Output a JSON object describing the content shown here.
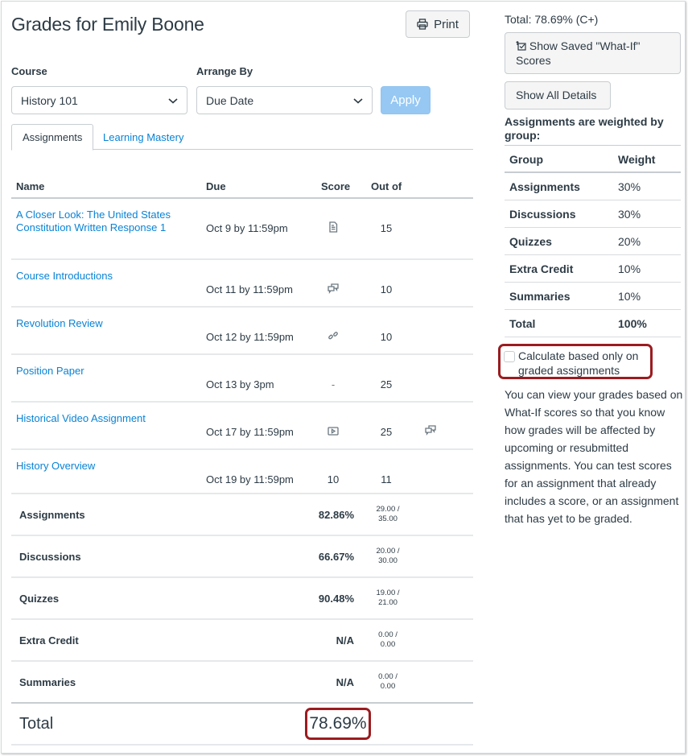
{
  "header": {
    "title": "Grades for Emily Boone",
    "print_label": "Print"
  },
  "filters": {
    "course_label": "Course",
    "course_value": "History 101",
    "arrange_label": "Arrange By",
    "arrange_value": "Due Date",
    "apply_label": "Apply"
  },
  "tabs": [
    {
      "label": "Assignments",
      "active": true
    },
    {
      "label": "Learning Mastery",
      "active": false
    }
  ],
  "table": {
    "columns": [
      "Name",
      "Due",
      "Score",
      "Out of"
    ],
    "assignments": [
      {
        "name": "A Closer Look: The United States Constitution Written Response 1",
        "due": "Oct 9 by 11:59pm",
        "score_icon": "document-icon",
        "score": "",
        "out_of": "15",
        "extra_icon": ""
      },
      {
        "name": "Course Introductions",
        "due": "Oct 11 by 11:59pm",
        "score_icon": "discussion-icon",
        "score": "",
        "out_of": "10",
        "extra_icon": ""
      },
      {
        "name": "Revolution Review",
        "due": "Oct 12 by 11:59pm",
        "score_icon": "link-icon",
        "score": "",
        "out_of": "10",
        "extra_icon": ""
      },
      {
        "name": "Position Paper",
        "due": "Oct 13 by 3pm",
        "score_icon": "",
        "score": "-",
        "out_of": "25",
        "extra_icon": ""
      },
      {
        "name": "Historical Video Assignment",
        "due": "Oct 17 by 11:59pm",
        "score_icon": "media-icon",
        "score": "",
        "out_of": "25",
        "extra_icon": "comments-icon"
      },
      {
        "name": "History Overview",
        "due": "Oct 19 by 11:59pm",
        "score_icon": "",
        "score": "10",
        "out_of": "11",
        "extra_icon": ""
      }
    ],
    "groups": [
      {
        "name": "Assignments",
        "percent": "82.86%",
        "points": "29.00 /",
        "possible": "35.00"
      },
      {
        "name": "Discussions",
        "percent": "66.67%",
        "points": "20.00 /",
        "possible": "30.00"
      },
      {
        "name": "Quizzes",
        "percent": "90.48%",
        "points": "19.00 /",
        "possible": "21.00"
      },
      {
        "name": "Extra Credit",
        "percent": "N/A",
        "points": "0.00 /",
        "possible": "0.00"
      },
      {
        "name": "Summaries",
        "percent": "N/A",
        "points": "0.00 /",
        "possible": "0.00"
      }
    ],
    "total_label": "Total",
    "total_value": "78.69%"
  },
  "sidebar": {
    "total": "Total: 78.69% (C+)",
    "whatif_label": "Show Saved \"What-If\" Scores",
    "details_label": "Show All Details",
    "weighted_note": "Assignments are weighted by group:",
    "weight_columns": [
      "Group",
      "Weight"
    ],
    "weights": [
      {
        "group": "Assignments",
        "weight": "30%"
      },
      {
        "group": "Discussions",
        "weight": "30%"
      },
      {
        "group": "Quizzes",
        "weight": "20%"
      },
      {
        "group": "Extra Credit",
        "weight": "10%"
      },
      {
        "group": "Summaries",
        "weight": "10%"
      },
      {
        "group": "Total",
        "weight": "100%"
      }
    ],
    "calc_label": "Calculate based only on graded assignments",
    "calc_checked": false,
    "help_text": "You can view your grades based on What-If scores so that you know how grades will be affected by upcoming or resubmitted assignments. You can test scores for an assignment that already includes a score, or an assignment that has yet to be graded."
  },
  "colors": {
    "link": "#0883d6",
    "text": "#2d3b45",
    "apply_disabled": "#96c8f3",
    "highlight": "#9b1c20"
  }
}
